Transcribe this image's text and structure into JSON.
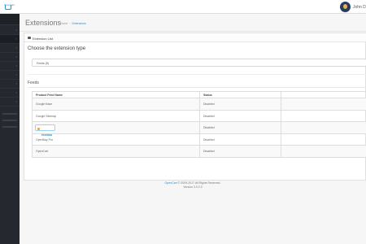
{
  "header": {
    "logo_text": "OpenCart",
    "user_name": "John D"
  },
  "breadcrumb": {
    "home": "Home",
    "current": "Extensions"
  },
  "page": {
    "title": "Extensions"
  },
  "panel": {
    "heading": "Extension List",
    "choose_type_title": "Choose the extension type",
    "selected_type": "Feeds (5)"
  },
  "feeds": {
    "title": "Feeds",
    "columns": [
      "Product Feed Name",
      "Status",
      ""
    ],
    "rows": [
      {
        "name": "Google Base",
        "status": "Disabled"
      },
      {
        "name": "Google Sitemap",
        "status": "Disabled"
      },
      {
        "name": "Hloraka",
        "status": "Disabled",
        "badge": true
      },
      {
        "name": "OpenBay Pro",
        "status": "Disabled"
      },
      {
        "name": "OpenCart",
        "status": "Disabled"
      }
    ]
  },
  "footer": {
    "brand": "OpenCart",
    "copyright": " © 2009-2017 All Rights Reserved.",
    "version": "Version 3.0.2.0"
  },
  "sidebar": {
    "stats": [
      {
        "label": "Orders Completed",
        "progress": 0.0
      },
      {
        "label": "Orders Processing",
        "progress": 0.0
      },
      {
        "label": "Other Statuses",
        "progress": 0.0
      }
    ]
  },
  "colors": {
    "accent": "#1e91cf",
    "sidebar": "#25292f"
  }
}
